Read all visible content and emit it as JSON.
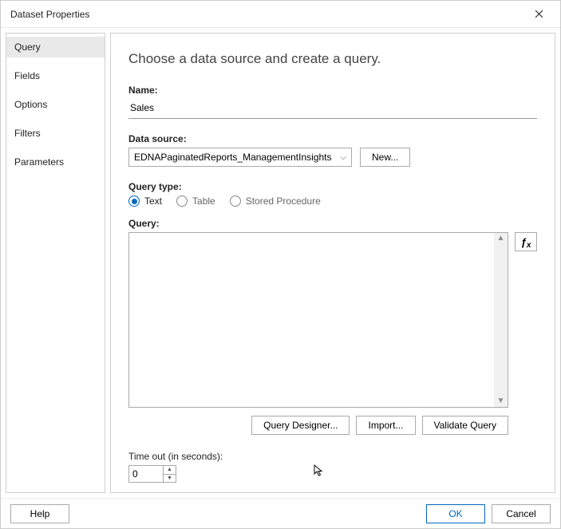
{
  "window": {
    "title": "Dataset Properties"
  },
  "sidebar": {
    "items": [
      {
        "label": "Query",
        "selected": true
      },
      {
        "label": "Fields"
      },
      {
        "label": "Options"
      },
      {
        "label": "Filters"
      },
      {
        "label": "Parameters"
      }
    ]
  },
  "main": {
    "heading": "Choose a data source and create a query.",
    "name_label": "Name:",
    "name_value": "Sales",
    "datasource_label": "Data source:",
    "datasource_value": "EDNAPaginatedReports_ManagementInsights",
    "new_button": "New...",
    "querytype_label": "Query type:",
    "radios": [
      {
        "label": "Text",
        "selected": true
      },
      {
        "label": "Table"
      },
      {
        "label": "Stored Procedure"
      }
    ],
    "query_label": "Query:",
    "query_value": "",
    "fx_label": "fx",
    "actions": {
      "designer": "Query Designer...",
      "import": "Import...",
      "validate": "Validate Query"
    },
    "timeout_label": "Time out (in seconds):",
    "timeout_value": "0"
  },
  "footer": {
    "help": "Help",
    "ok": "OK",
    "cancel": "Cancel"
  }
}
